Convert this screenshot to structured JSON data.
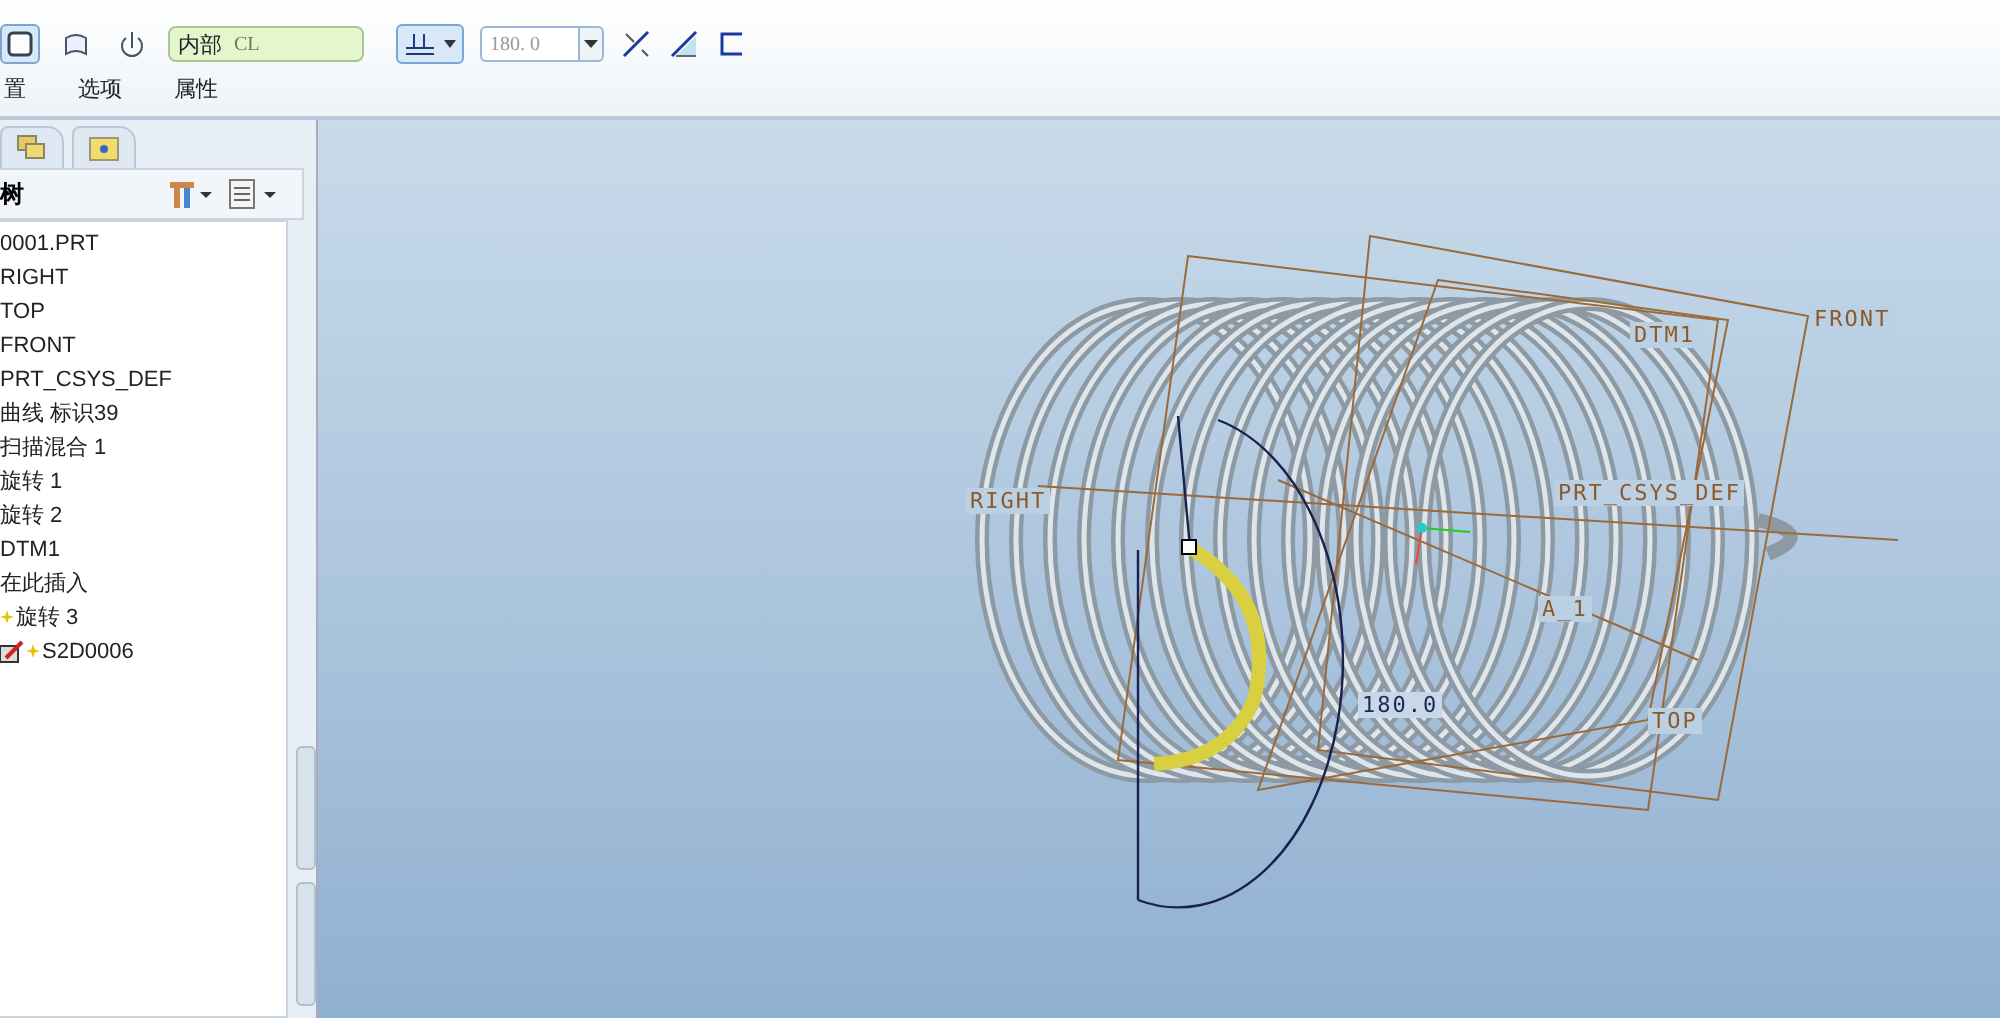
{
  "toolbar": {
    "buttons": [
      {
        "kind": "solid",
        "selected": true
      },
      {
        "kind": "surface",
        "selected": false
      },
      {
        "kind": "flip",
        "selected": false
      }
    ],
    "reference_field": {
      "label": "内部",
      "value": "CL"
    },
    "side_button": {
      "selected": true
    },
    "angle_field": {
      "value": "180. 0"
    },
    "tools": [
      {
        "kind": "remove"
      },
      {
        "kind": "thicken"
      },
      {
        "kind": "bracket"
      }
    ]
  },
  "tabs": [
    {
      "label": "置",
      "selected": false
    },
    {
      "label": "选项",
      "selected": false
    },
    {
      "label": "属性",
      "selected": false
    }
  ],
  "sidebar": {
    "title": "树",
    "items": [
      {
        "label": "0001.PRT",
        "kind": "plain"
      },
      {
        "label": "RIGHT",
        "kind": "plain"
      },
      {
        "label": "TOP",
        "kind": "plain"
      },
      {
        "label": "FRONT",
        "kind": "plain"
      },
      {
        "label": "PRT_CSYS_DEF",
        "kind": "plain"
      },
      {
        "label": "曲线 标识39",
        "kind": "plain"
      },
      {
        "label": "扫描混合 1",
        "kind": "plain"
      },
      {
        "label": "旋转 1",
        "kind": "plain"
      },
      {
        "label": "旋转 2",
        "kind": "plain"
      },
      {
        "label": "DTM1",
        "kind": "plain"
      },
      {
        "label": "在此插入",
        "kind": "plain"
      },
      {
        "label": "旋转 3",
        "kind": "new"
      },
      {
        "label": "S2D0006",
        "kind": "sketch"
      }
    ]
  },
  "viewport": {
    "labels": [
      {
        "text": "FRONT",
        "kind": "datum"
      },
      {
        "text": "DTM1",
        "kind": "datum"
      },
      {
        "text": "RIGHT",
        "kind": "datum"
      },
      {
        "text": "PRT_CSYS_DEF",
        "kind": "datum"
      },
      {
        "text": "A_1",
        "kind": "datum"
      },
      {
        "text": "TOP",
        "kind": "datum"
      },
      {
        "text": "180.0",
        "kind": "dimension"
      }
    ]
  }
}
